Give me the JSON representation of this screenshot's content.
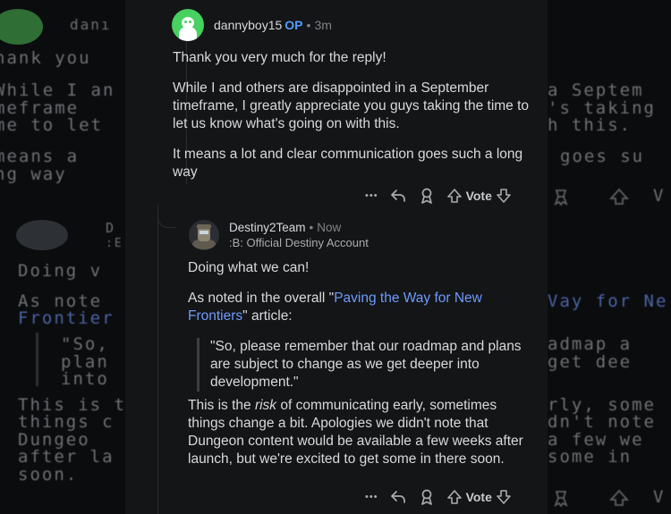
{
  "background": {
    "left_lines": [
      "danı",
      "hank you",
      "While I an",
      "meframe",
      "me to let",
      "means a",
      "ng way",
      "D",
      ":E",
      "Doing v",
      "As note",
      "Frontier",
      "\"So,",
      "plan",
      "into",
      "This is t",
      "things c",
      "Dungeo",
      "after la",
      "soon."
    ],
    "right_lines": [
      "a Septem",
      "'s taking",
      "h this.",
      "goes su",
      "Vay for Ne",
      "admap a",
      "get dee",
      "rly, some",
      "dn't note",
      "a few we",
      "some in"
    ],
    "vote_fragment": "V"
  },
  "comment1": {
    "username": "dannyboy15",
    "op_label": "OP",
    "time": "3m",
    "paragraphs": [
      "Thank you very much for the reply!",
      "While I and others are disappointed in a September timeframe, I greatly appreciate you guys taking the time to let us know what's going on with this.",
      "It means a lot and clear communication goes such a long way"
    ],
    "actions": {
      "more": "•••",
      "vote": "Vote"
    }
  },
  "comment2": {
    "username": "Destiny2Team",
    "time": "Now",
    "flair": ":B: Official Destiny Account",
    "p1": "Doing what we can!",
    "p2_prefix": "As noted in the overall \"",
    "p2_link": "Paving the Way for New Frontiers",
    "p2_suffix": "\" article:",
    "quote": "\"So, please remember that our roadmap and plans are subject to change as we get deeper into development.\"",
    "p3_prefix": "This is the ",
    "p3_em": "risk",
    "p3_suffix": " of communicating early, sometimes things change a bit. Apologies we didn't note that Dungeon content would be available a few weeks after launch, but we're excited to get some in there soon.",
    "actions": {
      "more": "•••",
      "vote": "Vote"
    }
  },
  "colors": {
    "op": "#4f9cff",
    "link": "#6e9bff",
    "avatar_green": "#46d160",
    "card": "#141516"
  }
}
